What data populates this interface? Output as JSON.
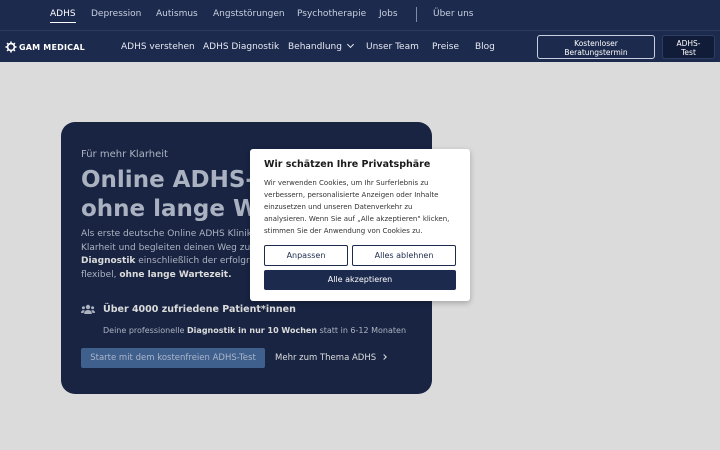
{
  "topbar": {
    "links": [
      "ADHS",
      "Depression",
      "Autismus",
      "Angststörungen",
      "Psychotherapie",
      "Jobs",
      "Über uns"
    ]
  },
  "nav": {
    "logo_text": "GAM MEDICAL",
    "links": [
      "ADHS verstehen",
      "ADHS Diagnostik",
      "Behandlung",
      "Unser Team",
      "Preise",
      "Blog"
    ],
    "btn_consult_line1": "Kostenloser",
    "btn_consult_line2": "Beratungstermin",
    "btn_test_line1": "ADHS-",
    "btn_test_line2": "Test"
  },
  "hero": {
    "eyebrow": "Für mehr Klarheit",
    "headline_line1": "Online ADHS-",
    "headline_line2": "ohne lange W",
    "body_line1": "Als erste deutsche Online ADHS Klinik",
    "body_line2": "Klarheit und begleiten deinen Weg zu",
    "body_line3_bold": "Diagnostik",
    "body_line3_rest": " einschließlich der erfolgre",
    "body_line4_a": "flexibel, ",
    "body_line4_bold": "ohne lange Wartezeit.",
    "stat": "Über 4000 zufriedene Patient*innen",
    "sub_a": "Deine professionelle ",
    "sub_bold": "Diagnostik in nur 10 Wochen",
    "sub_b": " statt in 6-12 Monaten",
    "cta": "Starte mit dem kostenfreien ADHS-Test",
    "more": "Mehr zum Thema ADHS"
  },
  "cookie": {
    "title": "Wir schätzen Ihre Privatsphäre",
    "text_line1": "Wir verwenden Cookies, um Ihr Surferlebnis zu",
    "text_line2": "verbessern, personalisierte Anzeigen oder Inhalte",
    "text_line3": "einzusetzen und unseren Datenverkehr zu",
    "text_line4": "analysieren. Wenn Sie auf „Alle akzeptieren\" klicken,",
    "text_line5": "stimmen Sie der Anwendung von Cookies zu.",
    "customize": "Anpassen",
    "reject": "Alles ablehnen",
    "accept": "Alle akzeptieren"
  }
}
